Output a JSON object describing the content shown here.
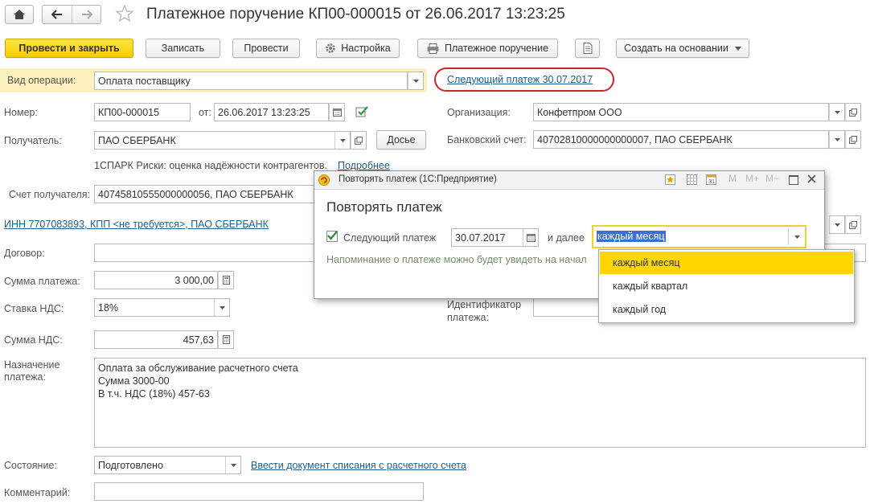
{
  "header": {
    "title": "Платежное поручение КП00-000015 от 26.06.2017 13:23:25"
  },
  "toolbar": {
    "post_close": "Провести и закрыть",
    "save": "Записать",
    "post": "Провести",
    "settings": "Настройка",
    "print": "Платежное поручение",
    "create_based": "Создать на основании"
  },
  "form": {
    "operation_label": "Вид операции:",
    "operation_value": "Оплата поставщику",
    "next_payment_link": "Следующий платеж 30.07.2017",
    "number_label": "Номер:",
    "number_value": "КП00-000015",
    "from_label": "от:",
    "date_value": "26.06.2017 13:23:25",
    "org_label": "Организация:",
    "org_value": "Конфетпром ООО",
    "recipient_label": "Получатель:",
    "recipient_value": "ПАО СБЕРБАНК",
    "dossier_button": "Досье",
    "bank_account_label": "Банковский счет:",
    "bank_account_value": "40702810000000000007, ПАО СБЕРБАНК",
    "spark_text": "1СПАРК Риски: оценка надёжности контрагентов.",
    "spark_link": "Подробнее",
    "recipient_account_label": "Счет получателя:",
    "recipient_account_value": "40745810555000000056, ПАО СБЕРБАНК",
    "inn_link": "ИНН 7707083893, КПП <не требуется>, ПАО СБЕРБАНК",
    "contract_label": "Договор:",
    "contract_value": "",
    "amount_label": "Сумма платежа:",
    "amount_value": "3 000,00",
    "vat_rate_label": "Ставка НДС:",
    "vat_rate_value": "18%",
    "payment_id_label_1": "Идентификатор",
    "payment_id_label_2": "платежа:",
    "vat_amount_label": "Сумма НДС:",
    "vat_amount_value": "457,63",
    "purpose_label_1": "Назначение",
    "purpose_label_2": "платежа:",
    "purpose_lines": [
      "Оплата за обслуживание расчетного счета",
      "Сумма 3000-00",
      "В т.ч. НДС  (18%) 457-63"
    ],
    "status_label": "Состояние:",
    "status_value": "Подготовлено",
    "write_off_link": "Ввести документ списания с расчетного счета",
    "comment_label": "Комментарий:",
    "comment_value": ""
  },
  "dialog": {
    "window_title": "Повторять платеж  (1С:Предприятие)",
    "heading": "Повторять платеж",
    "next_label": "Следующий  платеж",
    "next_date": "30.07.2017",
    "further_label": "и далее",
    "period_value": "каждый месяц",
    "hint": "Напоминание о платеже можно будет увидеть на начал",
    "checkbox_checked": true
  },
  "dropdown": {
    "options": [
      "каждый месяц",
      "каждый квартал",
      "каждый год"
    ],
    "selected_index": 0
  },
  "colors": {
    "primary_button": "#f5cd00",
    "highlight_bg": "#fdf1bf",
    "link": "#1d5f8e",
    "annotation_ring": "#d0252a",
    "selection": "#ffd700"
  }
}
